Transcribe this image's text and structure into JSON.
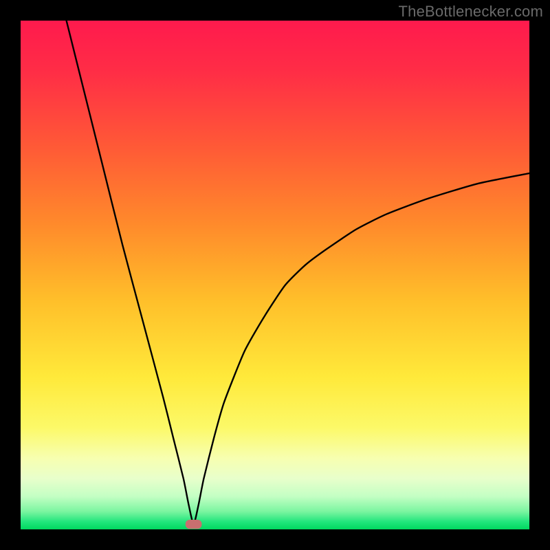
{
  "watermark": "TheBottlenecker.com",
  "colors": {
    "frame": "#000000",
    "curve": "#000000",
    "marker": "#c96f6f"
  },
  "chart_data": {
    "type": "line",
    "title": "",
    "xlabel": "",
    "ylabel": "",
    "xlim": [
      0,
      100
    ],
    "ylim": [
      0,
      100
    ],
    "grid": false,
    "curve": {
      "name": "bottleneck-v-curve",
      "description": "V-shaped bottleneck curve; minimum at ~x=34, y≈1. Left branch nearly vertical starting at (9,100); right branch asymptotes toward ~y≈70 at x=100.",
      "x": [
        9,
        12,
        16,
        20,
        24,
        28,
        30,
        32,
        33,
        34,
        35,
        36,
        38,
        40,
        44,
        48,
        52,
        56,
        60,
        66,
        72,
        80,
        90,
        100
      ],
      "y": [
        100,
        88,
        72,
        56,
        41,
        26,
        18,
        10,
        5,
        1,
        5,
        10,
        18,
        25,
        35,
        42,
        48,
        52,
        55,
        59,
        62,
        65,
        68,
        70
      ]
    },
    "marker": {
      "name": "optimal-point",
      "shape": "rounded-rect",
      "x": 34,
      "y": 1,
      "width_pct": 3.2,
      "height_pct": 1.8,
      "fill": "#c96f6f"
    },
    "background_gradient": {
      "type": "vertical",
      "stops": [
        {
          "pos": 0.0,
          "color": "#ff1a4d"
        },
        {
          "pos": 0.1,
          "color": "#ff2d46"
        },
        {
          "pos": 0.25,
          "color": "#ff5a36"
        },
        {
          "pos": 0.4,
          "color": "#ff8a2b"
        },
        {
          "pos": 0.55,
          "color": "#ffbf2a"
        },
        {
          "pos": 0.7,
          "color": "#ffe93a"
        },
        {
          "pos": 0.8,
          "color": "#fcf968"
        },
        {
          "pos": 0.86,
          "color": "#f7ffb0"
        },
        {
          "pos": 0.9,
          "color": "#e8ffcb"
        },
        {
          "pos": 0.935,
          "color": "#c4ffc4"
        },
        {
          "pos": 0.965,
          "color": "#7af5a0"
        },
        {
          "pos": 0.985,
          "color": "#22e67c"
        },
        {
          "pos": 1.0,
          "color": "#00d85f"
        }
      ]
    }
  }
}
